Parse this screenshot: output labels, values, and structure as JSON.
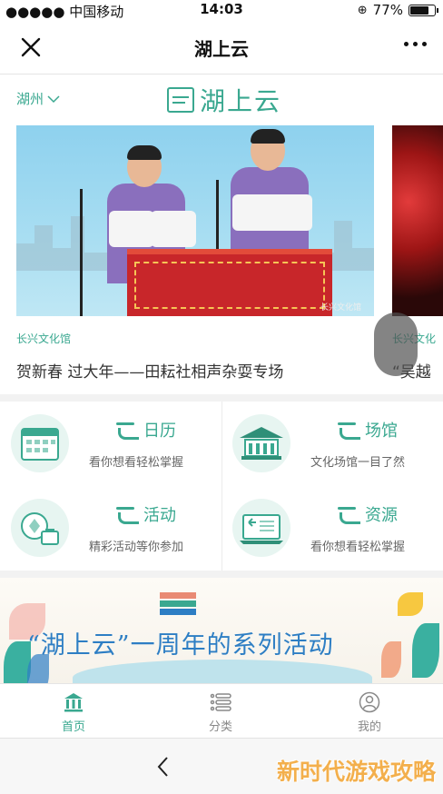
{
  "status_bar": {
    "carrier": "●●●●● 中国移动",
    "time": "14:03",
    "battery_percent": "77%",
    "battery_level": 0.77
  },
  "nav": {
    "title": "湖上云",
    "close_icon": "close-icon",
    "more_icon": "more-icon"
  },
  "header": {
    "city": "湖州",
    "logo_text": "湖上云"
  },
  "carousel": {
    "slides": [
      {
        "source": "长兴文化馆",
        "title": "贺新春 过大年——田耘社相声杂耍专场",
        "watermark": "长兴文化馆"
      },
      {
        "source": "长兴文化",
        "title": "“吴越"
      }
    ]
  },
  "features": [
    {
      "title": "日历",
      "subtitle": "看你想看轻松掌握",
      "icon": "calendar-icon"
    },
    {
      "title": "场馆",
      "subtitle": "文化场馆一目了然",
      "icon": "venue-icon"
    },
    {
      "title": "活动",
      "subtitle": "精彩活动等你参加",
      "icon": "activity-icon"
    },
    {
      "title": "资源",
      "subtitle": "看你想看轻松掌握",
      "icon": "resource-icon"
    }
  ],
  "promo": {
    "text": "“湖上云”一周年的系列活动"
  },
  "tabbar": {
    "items": [
      {
        "label": "首页",
        "icon": "home-icon",
        "active": true
      },
      {
        "label": "分类",
        "icon": "list-icon",
        "active": false
      },
      {
        "label": "我的",
        "icon": "user-icon",
        "active": false
      }
    ]
  },
  "watermark_text": "新时代游戏攻略",
  "colors": {
    "accent": "#3aa890",
    "promo_text": "#2d7ec4"
  }
}
